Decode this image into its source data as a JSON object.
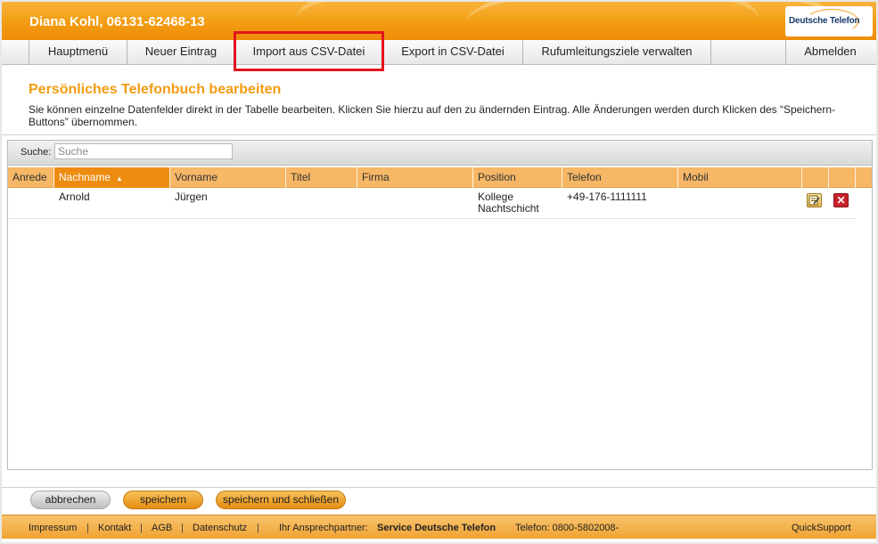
{
  "header": {
    "user_title": "Diana Kohl, 06131-62468-13",
    "logo_text": "Deutsche Telefon"
  },
  "nav": {
    "items": [
      "Hauptmenü",
      "Neuer Eintrag",
      "Import aus CSV-Datei",
      "Export in CSV-Datei",
      "Rufumleitungsziele verwalten",
      "Abmelden"
    ]
  },
  "page": {
    "title": "Persönliches Telefonbuch bearbeiten",
    "description": "Sie können einzelne Datenfelder direkt in der Tabelle bearbeiten. Klicken Sie hierzu auf den zu ändernden Eintrag. Alle Änderungen werden durch Klicken des “Speichern-Buttons” übernommen."
  },
  "search": {
    "label": "Suche:",
    "placeholder": "Suche"
  },
  "table": {
    "columns": [
      "Anrede",
      "Nachname",
      "Vorname",
      "Titel",
      "Firma",
      "Position",
      "Telefon",
      "Mobil"
    ],
    "sort_indicator": "▲",
    "rows": [
      {
        "anrede": "",
        "nachname": "Arnold",
        "vorname": "Jürgen",
        "titel": "",
        "firma": "",
        "position_line1": "Kollege",
        "position_line2": "Nachtschicht",
        "telefon": "+49-176-1111111",
        "mobil": ""
      }
    ]
  },
  "actions": {
    "cancel": "abbrechen",
    "save": "speichern",
    "save_close": "speichern und schließen"
  },
  "footer": {
    "impressum": "Impressum",
    "kontakt": "Kontakt",
    "agb": "AGB",
    "datenschutz": "Datenschutz",
    "partner_label": "Ihr Ansprechpartner:",
    "partner_name": "Service Deutsche Telefon",
    "phone": "Telefon: 0800-5802008-",
    "quicksupport": "QuickSupport",
    "separator": "|"
  },
  "colors": {
    "brand_orange": "#f39c12",
    "highlight_red": "#e3141d",
    "delete_red": "#c8222c"
  },
  "icons": [
    "edit-icon",
    "delete-icon",
    "sort-asc-icon"
  ]
}
